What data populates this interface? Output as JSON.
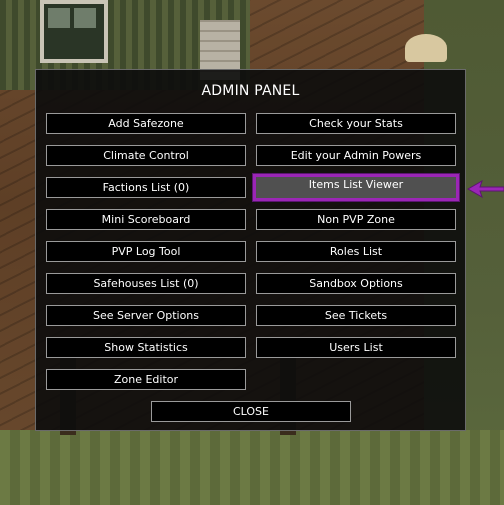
{
  "panel": {
    "title": "ADMIN PANEL",
    "left_buttons": [
      "Add Safezone",
      "Climate Control",
      "Factions List (0)",
      "Mini Scoreboard",
      "PVP Log Tool",
      "Safehouses List (0)",
      "See Server Options",
      "Show Statistics",
      "Zone Editor"
    ],
    "right_buttons": [
      "Check your Stats",
      "Edit your Admin Powers",
      "Items List Viewer",
      "Non PVP Zone",
      "Roles List",
      "Sandbox Options",
      "See Tickets",
      "Users List"
    ],
    "selected_button": "Items List Viewer",
    "close_label": "CLOSE"
  },
  "colors": {
    "highlight_border": "#9b26b6",
    "arrow": "#9b26b6",
    "panel_bg": "#0c0c0c",
    "button_border": "#9a9a9a"
  },
  "icons": {
    "pointer_arrow": "arrow-left-icon"
  }
}
